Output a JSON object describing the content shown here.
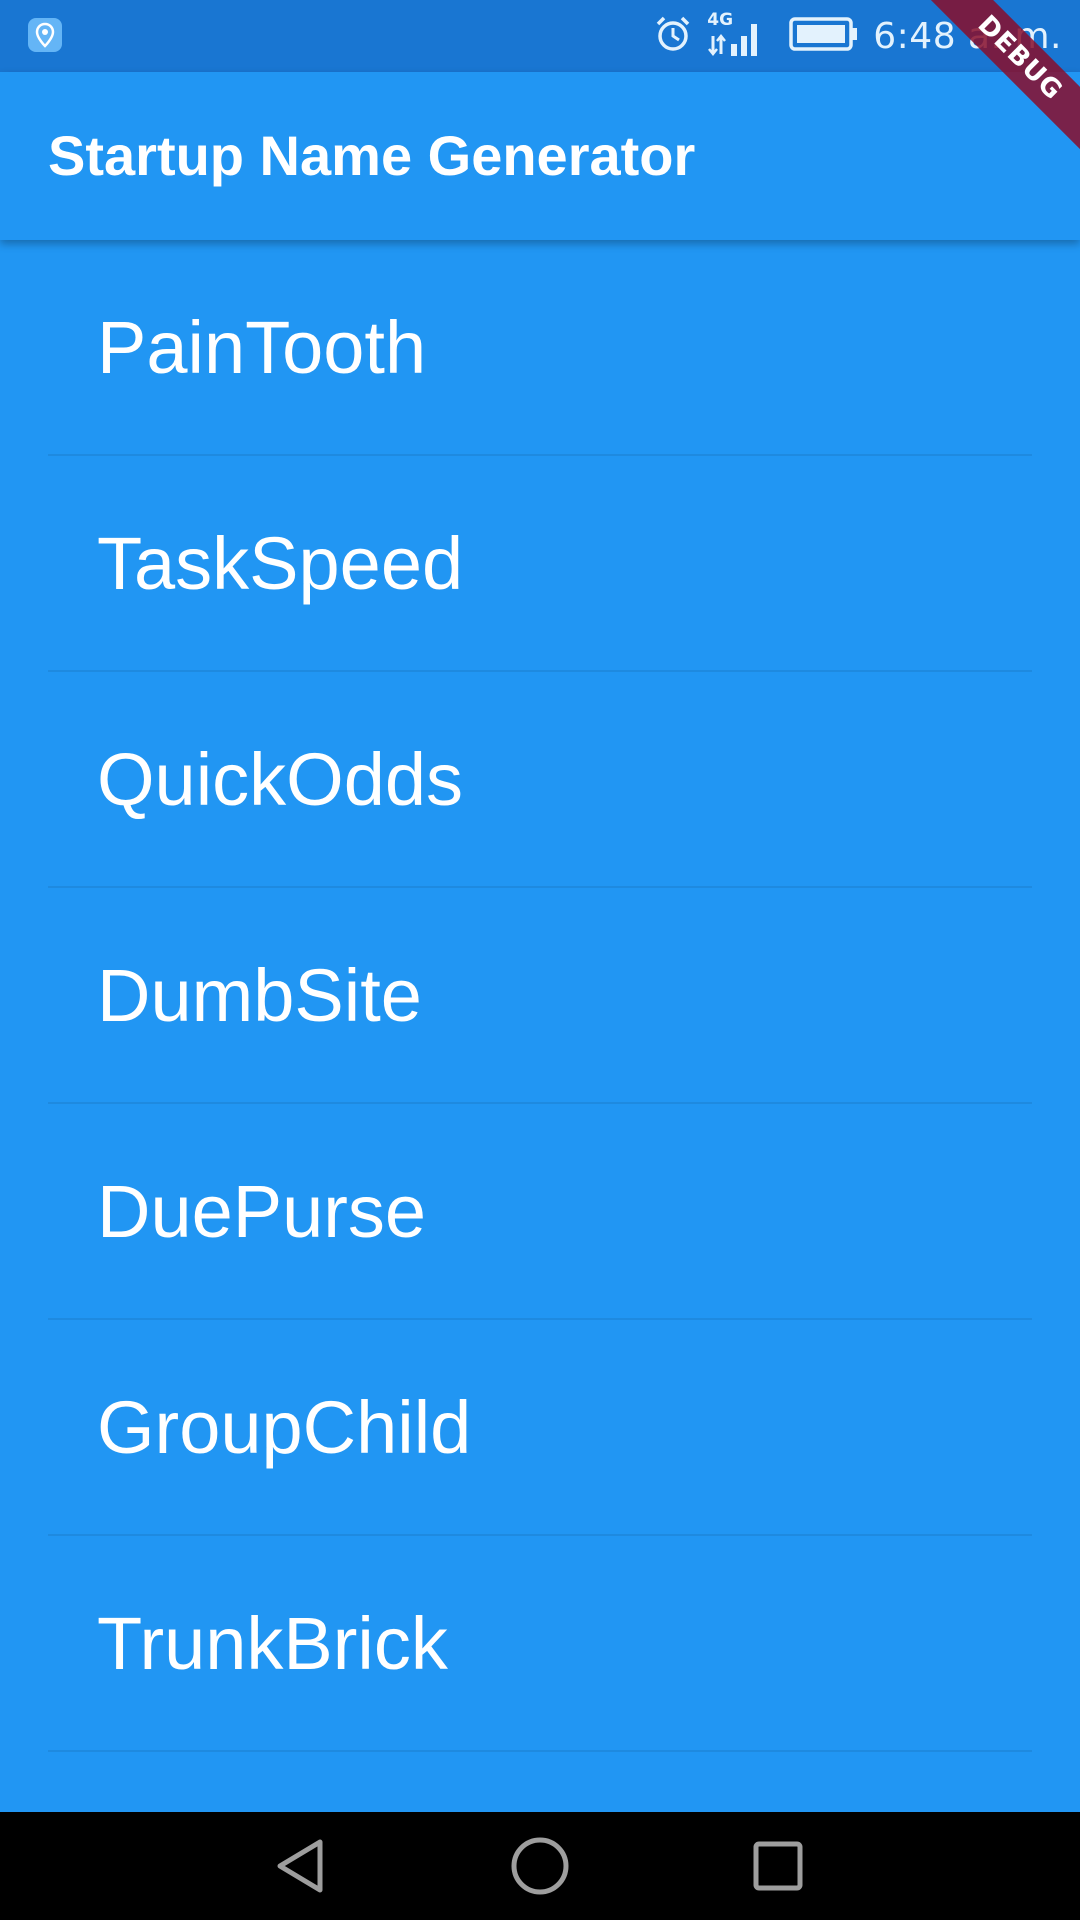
{
  "status_bar": {
    "time": "6:48 a. m.",
    "network": "4G",
    "icons": [
      "location-icon",
      "alarm-icon",
      "signal-icon",
      "battery-icon"
    ]
  },
  "debug_banner": "DEBUG",
  "app_bar": {
    "title": "Startup Name Generator"
  },
  "list": {
    "items": [
      {
        "label": "PainTooth"
      },
      {
        "label": "TaskSpeed"
      },
      {
        "label": "QuickOdds"
      },
      {
        "label": "DumbSite"
      },
      {
        "label": "DuePurse"
      },
      {
        "label": "GroupChild"
      },
      {
        "label": "TrunkBrick"
      }
    ]
  },
  "nav_bar": {
    "buttons": [
      "back-icon",
      "home-icon",
      "recents-icon"
    ]
  },
  "colors": {
    "primary": "#2196F3",
    "status_bar": "#1976D2",
    "nav_bar": "#000000",
    "debug_banner": "#880E2C",
    "text": "#FFFFFF"
  }
}
